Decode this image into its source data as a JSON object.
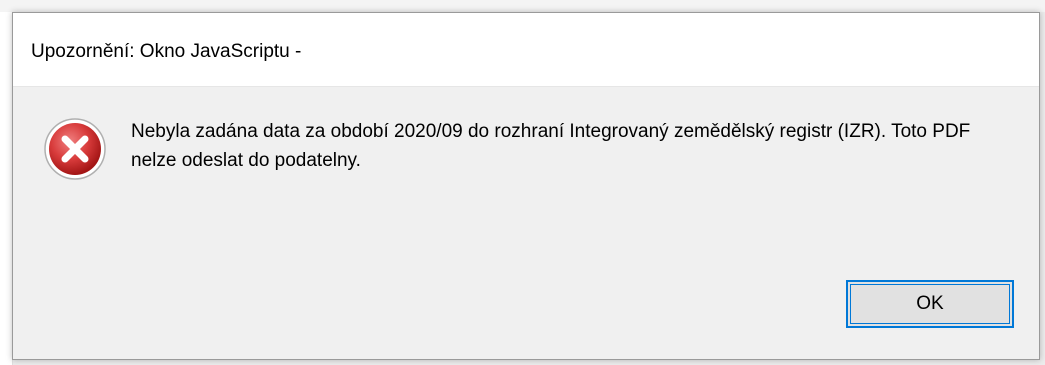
{
  "dialog": {
    "title": "Upozornění: Okno JavaScriptu -",
    "icon": "error-icon",
    "message": "Nebyla zadána data za období 2020/09 do rozhraní Integrovaný zemědělský registr (IZR). Toto PDF nelze odeslat do podatelny.",
    "ok_label": "OK"
  },
  "colors": {
    "error_red": "#d83b3b",
    "accent_blue": "#0078d7",
    "dialog_bg": "#f0f0f0",
    "titlebar_bg": "#ffffff"
  }
}
